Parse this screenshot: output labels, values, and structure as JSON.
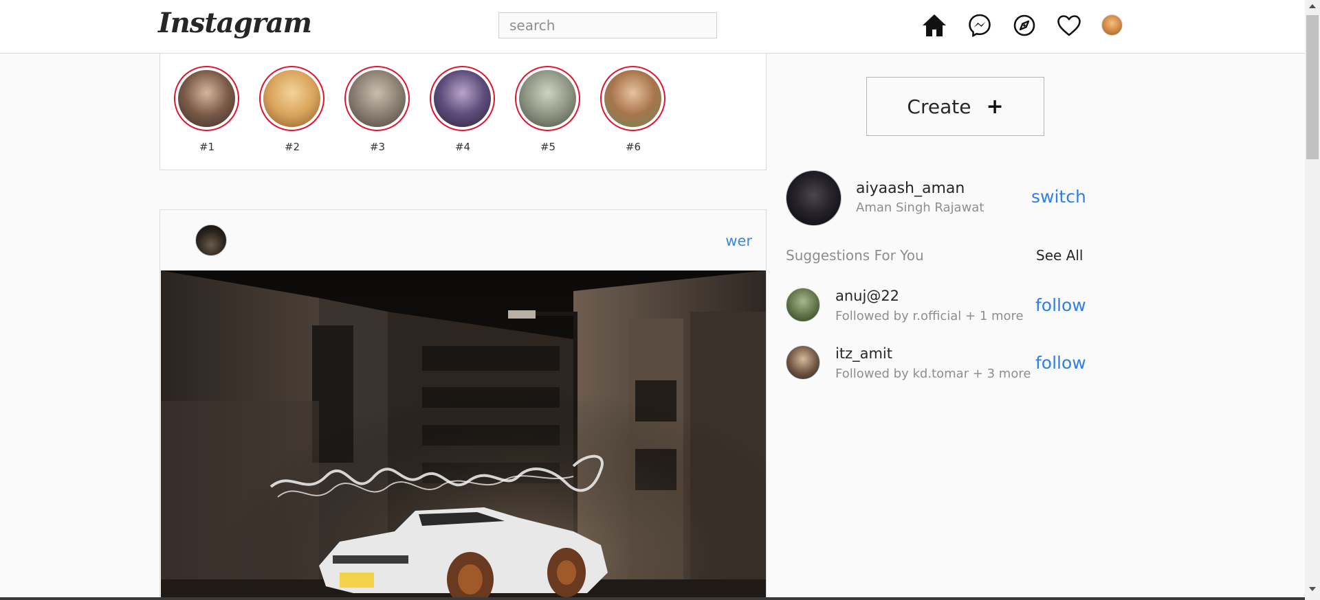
{
  "navbar": {
    "logo": "Instagram",
    "search_placeholder": "search",
    "icons": [
      "home-icon",
      "messenger-icon",
      "explore-icon",
      "heart-icon"
    ]
  },
  "stories": [
    {
      "label": "#1"
    },
    {
      "label": "#2"
    },
    {
      "label": "#3"
    },
    {
      "label": "#4"
    },
    {
      "label": "#5"
    },
    {
      "label": "#6"
    }
  ],
  "post": {
    "action": "wer"
  },
  "sidebar": {
    "create_label": "Create",
    "create_icon": "+",
    "profile": {
      "username": "aiyaash_aman",
      "name": "Aman Singh Rajawat",
      "switch_label": "switch"
    },
    "suggestions_title": "Suggestions For You",
    "see_all": "See All",
    "suggestions": [
      {
        "username": "anuj@22",
        "meta": "Followed by r.official + 1 more",
        "action": "follow"
      },
      {
        "username": "itz_amit",
        "meta": "Followed by kd.tomar + 3 more",
        "action": "follow"
      }
    ]
  },
  "colors": {
    "accent": "#2f7fe6",
    "story_ring": "#e3122d",
    "background": "#fafafa"
  }
}
